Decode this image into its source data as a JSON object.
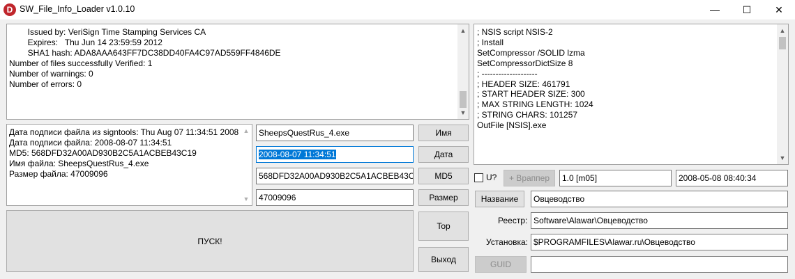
{
  "window": {
    "title": "SW_File_Info_Loader v1.0.10",
    "icon_letter": "D",
    "minimize_glyph": "—",
    "maximize_glyph": "☐",
    "close_glyph": "✕"
  },
  "verify_log": {
    "lines": [
      "        Issued by: VeriSign Time Stamping Services CA",
      "        Expires:   Thu Jun 14 23:59:59 2012",
      "        SHA1 hash: ADA8AAA643FF7DC38DD40FA4C97AD559FF4846DE",
      "",
      "Number of files successfully Verified: 1",
      "Number of warnings: 0",
      "Number of errors: 0"
    ]
  },
  "nsis_script": {
    "lines": [
      "; NSIS script NSIS-2",
      "; Install",
      "",
      "SetCompressor /SOLID lzma",
      "SetCompressorDictSize 8",
      "",
      "; --------------------",
      "; HEADER SIZE: 461791",
      "; START HEADER SIZE: 300",
      "; MAX STRING LENGTH: 1024",
      "; STRING CHARS: 101257",
      "",
      "OutFile [NSIS].exe"
    ]
  },
  "file_info": {
    "lines": [
      "Дата подписи файла из signtools: Thu Aug 07 11:34:51 2008",
      "Дата подписи файла: 2008-08-07 11:34:51",
      "MD5: 568DFD32A00AD930B2C5A1ACBEB43C19",
      "Имя файла: SheepsQuestRus_4.exe",
      "Размер файла: 47009096"
    ]
  },
  "fields": {
    "name_value": "SheepsQuestRus_4.exe",
    "date_value": "2008-08-07 11:34:51",
    "md5_value": "568DFD32A00AD930B2C5A1ACBEB43C19",
    "size_value": "47009096",
    "version_value": "1.0 [m05]",
    "build_date_value": "2008-05-08 08:40:34",
    "title_value": "Овцеводство",
    "registry_value": "Software\\Alawar\\Овцеводство",
    "install_value": "$PROGRAMFILES\\Alawar.ru\\Овцеводство",
    "guid_value": ""
  },
  "buttons": {
    "name": "Имя",
    "date": "Дата",
    "md5": "MD5",
    "size": "Размер",
    "top": "Top",
    "exit": "Выход",
    "start": "ПУСК!",
    "wrapper": "+ Враппер",
    "title": "Название",
    "guid": "GUID"
  },
  "labels": {
    "u_checkbox": "U?",
    "registry": "Реестр:",
    "install": "Установка:"
  },
  "checkbox": {
    "u_checked": false
  }
}
